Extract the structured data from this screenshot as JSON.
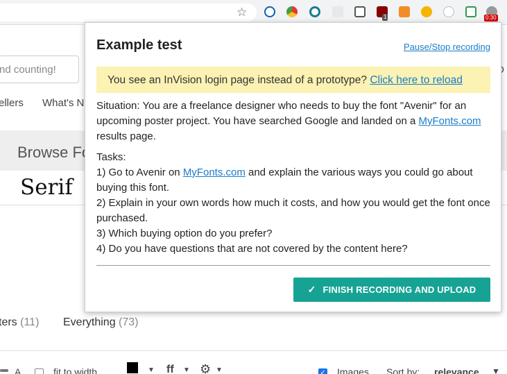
{
  "browser": {
    "star_icon": "star-icon",
    "extension_badge": "1",
    "recording_timer": "0:30"
  },
  "background_page": {
    "search_placeholder": "nd counting!",
    "nav": [
      "ellers",
      "What's N"
    ],
    "right_fragment": "O",
    "browse_heading": "Browse Fo",
    "serif_label": "Serif",
    "filters": [
      {
        "label": "ters",
        "count": "(11)"
      },
      {
        "label": "Everything",
        "count": "(73)"
      }
    ],
    "bottom": {
      "a_label": "A",
      "fit_to_width": "fit to width",
      "images_label": "Images",
      "sort_by_label": "Sort by:",
      "sort_value": "relevance"
    }
  },
  "popup": {
    "title": "Example test",
    "pause_link": "Pause/Stop recording",
    "warning": {
      "text": "You see an InVision login page instead of a prototype?",
      "link": "Click here to reload"
    },
    "situation": {
      "before": "Situation: You are a freelance designer who needs to buy the font \"Avenir\" for an upcoming poster project. You have searched Google and landed on a ",
      "link": "MyFonts.com",
      "after": " results page."
    },
    "tasks_heading": "Tasks:",
    "task1": {
      "before": "1) Go to Avenir on ",
      "link": "MyFonts.com",
      "after": " and explain the various ways you could go about buying this font."
    },
    "task2": "2) Explain in your own words how much it costs, and how you would get the font once purchased.",
    "task3": "3) Which buying option do you prefer?",
    "task4": "4) Do you have questions that are not covered by the content here?",
    "finish_button": "FINISH RECORDING AND UPLOAD"
  }
}
